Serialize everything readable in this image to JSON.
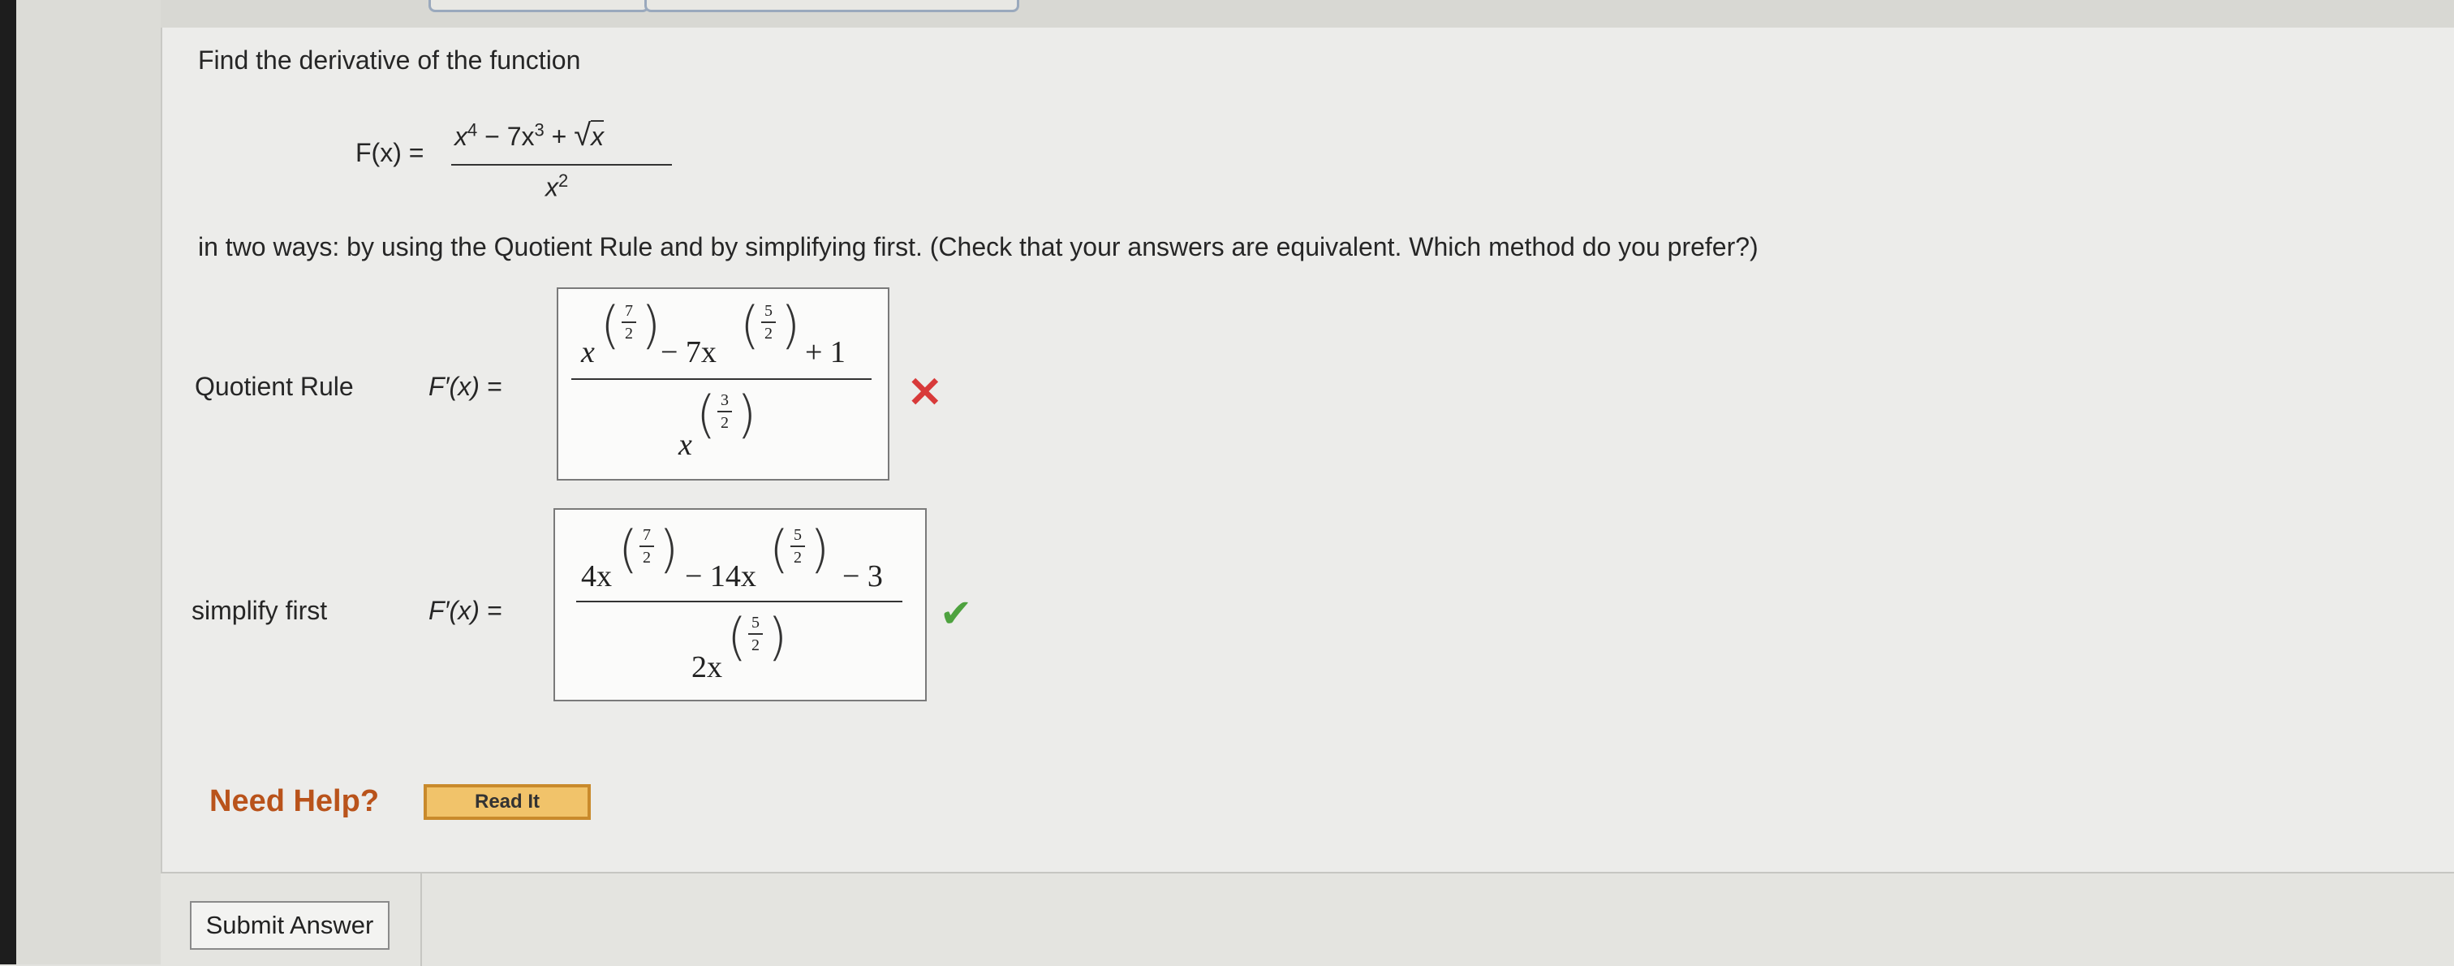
{
  "question": {
    "prompt": "Find the derivative of the function",
    "function_lhs": "F(x) =",
    "numerator": {
      "t1": "x",
      "t1_exp": "4",
      "t2": " − 7x",
      "t2_exp": "3",
      "t3": " + ",
      "radicand": "x"
    },
    "denominator": {
      "base": "x",
      "exp": "2"
    },
    "instructions": "in two ways: by using the Quotient Rule and by simplifying first. (Check that your answers are equivalent. Which method do you prefer?)"
  },
  "quotient_rule": {
    "label": "Quotient Rule",
    "lhs": "F′(x)  =",
    "num": {
      "a": "x",
      "a_exp_n": "7",
      "a_exp_d": "2",
      "b": " − 7x",
      "b_exp_n": "5",
      "b_exp_d": "2",
      "c": "+ 1"
    },
    "den": {
      "base": "x",
      "exp_n": "3",
      "exp_d": "2"
    },
    "status": "incorrect",
    "status_icon": "✕"
  },
  "simplify_first": {
    "label": "simplify first",
    "lhs": "F′(x)  =",
    "num": {
      "a": "4x",
      "a_exp_n": "7",
      "a_exp_d": "2",
      "b": "− 14x",
      "b_exp_n": "5",
      "b_exp_d": "2",
      "c": "− 3"
    },
    "den": {
      "base": "2x",
      "exp_n": "5",
      "exp_d": "2"
    },
    "status": "correct",
    "status_icon": "✔"
  },
  "help": {
    "label": "Need Help?",
    "read_it": "Read It"
  },
  "submit": {
    "label": "Submit Answer"
  },
  "colors": {
    "incorrect": "#d83a3a",
    "correct": "#4ea23f",
    "help_text": "#b9531b",
    "read_it_bg": "#f1c36a"
  }
}
